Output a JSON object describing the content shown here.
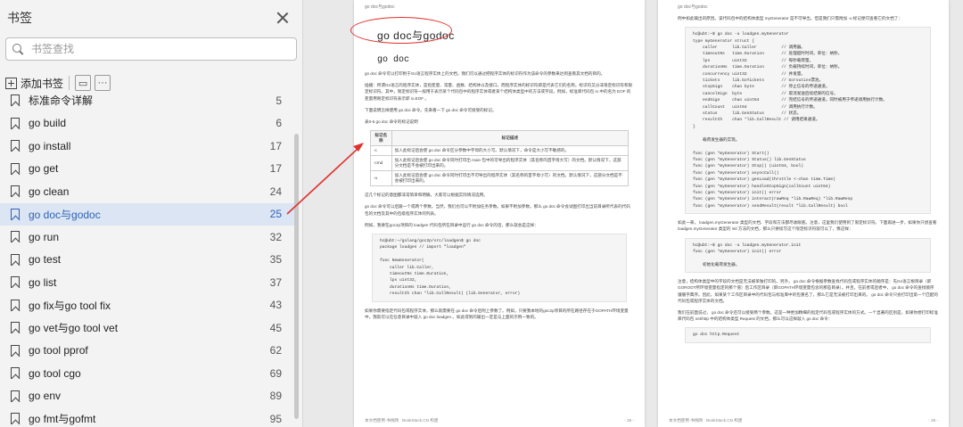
{
  "sidebar": {
    "title": "书签",
    "search_placeholder": "书签查找",
    "add_bookmark_label": "添加书签",
    "more_label": "···",
    "items": [
      {
        "label": "标准命令详解",
        "page": "5",
        "active": false
      },
      {
        "label": "go build",
        "page": "6",
        "active": false
      },
      {
        "label": "go install",
        "page": "17",
        "active": false
      },
      {
        "label": "go get",
        "page": "17",
        "active": false
      },
      {
        "label": "go clean",
        "page": "24",
        "active": false
      },
      {
        "label": "go doc与godoc",
        "page": "25",
        "active": true
      },
      {
        "label": "go run",
        "page": "32",
        "active": false
      },
      {
        "label": "go test",
        "page": "35",
        "active": false
      },
      {
        "label": "go list",
        "page": "37",
        "active": false
      },
      {
        "label": "go fix与go tool fix",
        "page": "43",
        "active": false
      },
      {
        "label": "go vet与go tool vet",
        "page": "45",
        "active": false
      },
      {
        "label": "go tool pprof",
        "page": "62",
        "active": false
      },
      {
        "label": "go tool cgo",
        "page": "69",
        "active": false
      },
      {
        "label": "go env",
        "page": "89",
        "active": false
      },
      {
        "label": "go fmt与gofmt",
        "page": "95",
        "active": false
      }
    ]
  },
  "left_page": {
    "running_head": "go doc与godoc",
    "heading": "go doc与godoc",
    "subheading": "go doc",
    "para1": "go doc 命令可以打印附于Go语言程序实体上的文档。我们可以通过把程序实体的标识符作为该命令的参数来达到查看其文档的目的。",
    "para2": "插播：所谓Go语言的程序实体，是指变量、常量、函数、结构体以及接口。而程序实体的标识符即是代表它们的名称。标识符又分非限定标识符和限定标识符。其中，限定标识符一般用于表示某个代码包中的程序实体或者某个结构体类型中的方法或字段。例如，标准库代码包 io 中的名为 EOF 的变量用限定标识符表示即 io.EOF 。",
    "para3": "下面说明怎样使用 go doc 命令。先来看一下 go doc 命令可接受的标记。",
    "table_caption": "表0-5  go doc 命令的标记说明",
    "table_headers": [
      "标记名称",
      "标记描述"
    ],
    "table_rows": [
      [
        "-c",
        "加入此标记后会使 go doc 命令区分参数中字母的大小写。默认情况下，命令是大小写不敏感的。"
      ],
      [
        "-cmd",
        "加入此标记后会使 go doc 命令同时打印出 main 包中的可导出的程序实体（其名称的首字母大写）的文档。默认情况下，这部分文档是不会被打印出来的。"
      ],
      [
        "-u",
        "加入此标记后会使 go doc 命令同时打印出不可导出的程序实体（其名称的首字母小写）的文档。默认情况下，这部分文档是不会被打印出来的。"
      ]
    ],
    "para4": "这几个标记的意图都非常简单和明确，大家可以根据实际情况选用。",
    "para5": "go doc 命令可以后跟一个或两个参数。当然，我们也可以不附加任务参数。如果不附加参数，那么 go doc 命令会试图打印出当前目录所代表的代码包的文档及其中的包级程序实体的列表。",
    "para6": "例如，我要在goc2p项目的 loadgen 代码包所在目录中运行 go doc 命令的话，那么就会是这样：",
    "code": "hc@ubt:~/golang/goc2p/src/loadgen$ go doc\npackage loadgen // import \"loadgen\"\n\nfunc NewGenerator(\n    caller lib.Caller,\n    timeoutNs time.Duration,\n    lps uint32,\n    durationNs time.Duration,\n    resultCh chan *lib.CallResult) (lib.Generator, error)",
    "para7": "如果你需要指定代码包或程序实体，那么就需要在 go doc 命令后附上参数了。例如，只要我本地的goc2p项目的所在路径存在于GOPATH环境变量中，我就可以在任意目录中敲入 go doc loadgen 。如此得到的输出一定是与上面的示例一致的。",
    "footer_left": "本文档使用 书栈网 · BookStack.CN 构建",
    "footer_right": "- 25 -"
  },
  "right_page": {
    "running_head": "go doc与godoc",
    "para1": "例中如此输出的原因。该代码包中的结构体类型 myGenerator 是不可导出，但是我们只需附加 -u 标记便可查看它的文档了：",
    "code1": "hc@ubt:~$ go doc -u loadgen.myGenerator\ntype myGenerator struct {\n    caller      lib.Caller          // 调用器。\n    timeoutNs   time.Duration       // 处理超时时间，单位：纳秒。\n    lps         uint32              // 每秒载荷量。\n    durationNs  time.Duration       // 负载持续时间，单位：纳秒。\n    concurrency uint32              // 并发量。\n    tickets     lib.GoTickets       // Goroutine票池。\n    stopSign    chan byte           // 停止信号的传递通道。\n    cancelSign  byte                // 取消发送后续结果的信号。\n    endSign     chan uint64         // 完结信号的传递通道，同时被用于传递调用执行计数。\n    callCount   uint64              // 调用执行计数。\n    status      lib.GenStatus       // 状态。\n    resultCh    chan *lib.CallResult // 调用结果通道。\n}\n\n    载荷发生器的实现。\n\nfunc (gen *myGenerator) Start()\nfunc (gen *myGenerator) Status() lib.GenStatus\nfunc (gen *myGenerator) Stop() (uint64, bool)\nfunc (gen *myGenerator) asyncCall()\nfunc (gen *myGenerator) genLoad(throttle <-chan time.Time)\nfunc (gen *myGenerator) handleStopSign(callCount uint64)\nfunc (gen *myGenerator) init() error\nfunc (gen *myGenerator) interact(rawReq *lib.RawReq) *lib.RawResp\nfunc (gen *myGenerator) sendResult(result *lib.CallResult) bool",
    "para2": "如此一来， loadgen.myGenerator 类型的文档、字段和方法都尽收眼底。注意，这里我们使用到了限定标识符。下面再进一步，如果你只想查看 loadgen.myGenerator 类型的 init 方法的文档，那么只要续写这个限定标识符就可以了，像这样：",
    "code2": "hc@ubt:~$ go doc -u loadgen.myGenerator.init\nfunc (gen *myGenerator) init() error\n\n    初始化载荷发生器。",
    "para3": "注意，结构体类型中的字段的文档是无法被单独打印的。另外， go doc 命令根据参数查找代码包或程序实体的顺序是：先Go语言根目录（即GOROOT所环境变量指定的那个值）后工作区目录（即GOPATH环境变量包含的那些目录）。并且，在前者或后者中， go doc 命令的查找顺序遵循字典序。因此，如果某个工作区目录中的代码包与标准库中的包重名了，那么它是无法被打印出来的。 go doc 命令只会打印出第一个匹配的代码包或程序实体的文档。",
    "para4": "我们在前面说过， go doc 命令还可以接受两个参数。这是一种更加精细的指定代码包或程序实体的方式。一个显著的区别是，如果你想打印标准库代码包 net/http 中的结构体类型 Request 的文档，那么可以这样敲入 go doc 命令：",
    "code3": "go doc http.Request",
    "footer_left": "本文档使用 书栈网 · BookStack.CN 构建",
    "footer_right": "- 26 -"
  },
  "colors": {
    "annotation_red": "#e0312f",
    "active_text": "#2f63b4",
    "active_bg": "#dbe5f3"
  }
}
